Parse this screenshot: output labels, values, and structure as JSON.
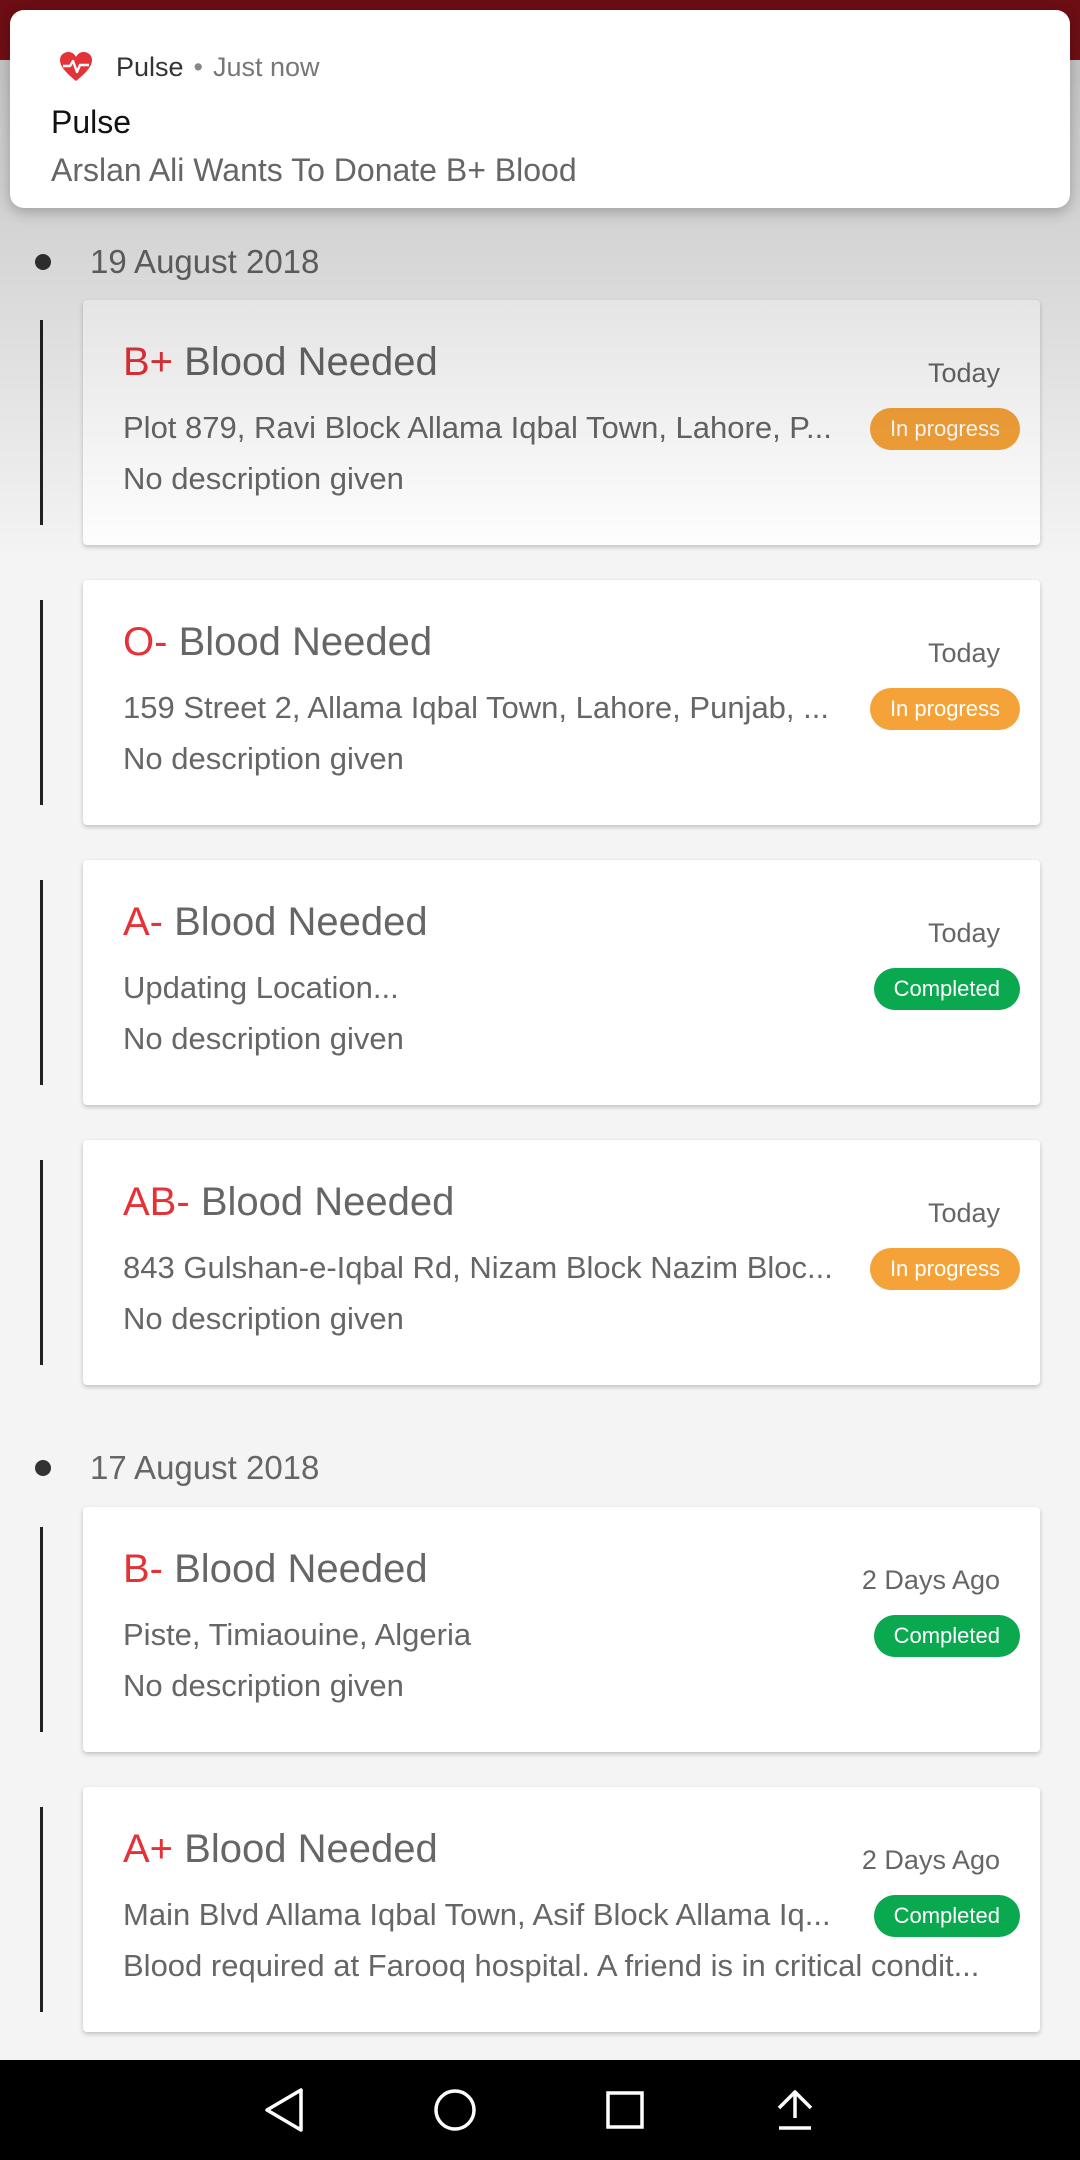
{
  "notification": {
    "app_name": "Pulse",
    "separator": "•",
    "time": "Just now",
    "title": "Pulse",
    "body": "Arslan Ali Wants To Donate B+ Blood",
    "icon": "heart-pulse-icon",
    "icon_color": "#e53238"
  },
  "colors": {
    "blood_type": "#e53238",
    "in_progress": "#f5a238",
    "completed": "#0aa84f",
    "top_bar": "#8a1219"
  },
  "groups": [
    {
      "date": "19 August 2018",
      "requests": [
        {
          "blood_type": "B+",
          "title_suffix": "Blood Needed",
          "time": "Today",
          "address": "Plot 879, Ravi Block Allama Iqbal Town, Lahore, P...",
          "description": "No description given",
          "status": "In progress"
        },
        {
          "blood_type": "O-",
          "title_suffix": "Blood Needed",
          "time": "Today",
          "address": "159 Street 2, Allama Iqbal Town, Lahore, Punjab, ...",
          "description": "No description given",
          "status": "In progress"
        },
        {
          "blood_type": "A-",
          "title_suffix": "Blood Needed",
          "time": "Today",
          "address": "Updating Location...",
          "description": "No description given",
          "status": "Completed"
        },
        {
          "blood_type": "AB-",
          "title_suffix": "Blood Needed",
          "time": "Today",
          "address": "843 Gulshan-e-Iqbal Rd, Nizam Block Nazim Bloc...",
          "description": "No description given",
          "status": "In progress"
        }
      ]
    },
    {
      "date": "17 August 2018",
      "requests": [
        {
          "blood_type": "B-",
          "title_suffix": "Blood Needed",
          "time": "2 Days Ago",
          "address": "Piste, Timiaouine, Algeria",
          "description": "No description given",
          "status": "Completed"
        },
        {
          "blood_type": "A+",
          "title_suffix": "Blood Needed",
          "time": "2 Days Ago",
          "address": "Main Blvd Allama Iqbal Town, Asif Block Allama Iq...",
          "description": "Blood required at Farooq hospital. A friend is in critical condit...",
          "status": "Completed"
        }
      ]
    }
  ],
  "nav": {
    "back": "back-icon",
    "home": "home-icon",
    "recents": "recents-icon",
    "share": "share-icon"
  }
}
